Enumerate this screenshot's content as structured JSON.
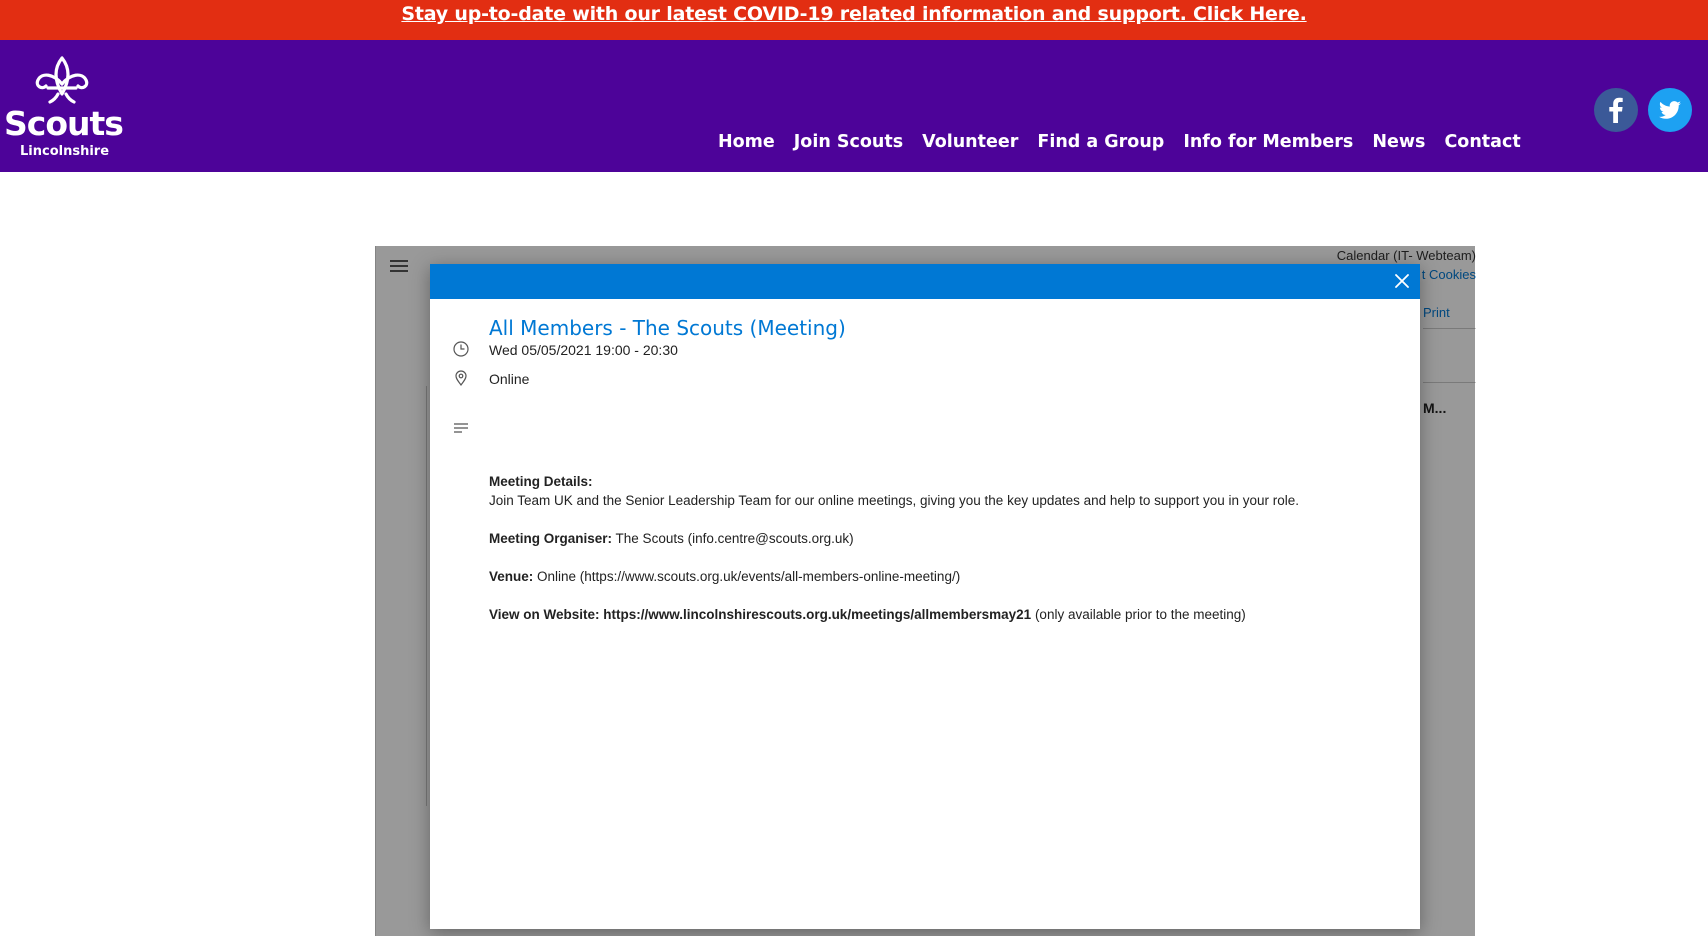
{
  "banner": {
    "text": "Stay up-to-date with our latest COVID-19 related information and support. Click Here."
  },
  "header": {
    "logo_word": "Scouts",
    "logo_sub": "Lincolnshire",
    "nav": [
      "Home",
      "Join Scouts",
      "Volunteer",
      "Find a Group",
      "Info for Members",
      "News",
      "Contact"
    ],
    "social": {
      "facebook": "facebook-icon",
      "twitter": "twitter-icon"
    }
  },
  "calendar": {
    "title": "Calendar (IT- Webteam)",
    "cookies_label": "Cookies",
    "cookies_prefix": "t",
    "print_label": "Print",
    "truncated_item": "M..."
  },
  "modal": {
    "title": "All Members - The Scouts (Meeting)",
    "datetime": "Wed 05/05/2021 19:00 - 20:30",
    "location": "Online",
    "details_heading": "Meeting Details:",
    "details_body": "Join Team UK and the Senior Leadership Team for our online meetings, giving you the key updates and help to support you in your role.",
    "organiser_label": "Meeting Organiser:",
    "organiser_value": "The Scouts (info.centre@scouts.org.uk)",
    "venue_label": "Venue:",
    "venue_value": "Online (https://www.scouts.org.uk/events/all-members-online-meeting/)",
    "website_label": "View on Website:",
    "website_link": "https://www.lincolnshirescouts.org.uk/meetings/allmembersmay21",
    "website_note": "(only available prior to the meeting)"
  },
  "colors": {
    "banner": "#e22e12",
    "header": "#4d0399",
    "accent": "#0078d4",
    "facebook": "#3b5998",
    "twitter": "#1da1f2"
  }
}
